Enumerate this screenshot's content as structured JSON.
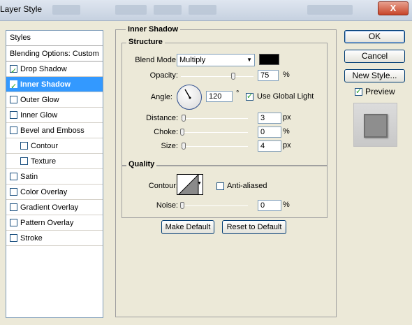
{
  "window": {
    "title": "Layer Style",
    "close_label": "X"
  },
  "styles_panel": {
    "header": "Styles",
    "blending": "Blending Options: Custom",
    "items": [
      {
        "label": "Drop Shadow",
        "checked": true,
        "selected": false,
        "indent": false
      },
      {
        "label": "Inner Shadow",
        "checked": true,
        "selected": true,
        "indent": false
      },
      {
        "label": "Outer Glow",
        "checked": false,
        "selected": false,
        "indent": false
      },
      {
        "label": "Inner Glow",
        "checked": false,
        "selected": false,
        "indent": false
      },
      {
        "label": "Bevel and Emboss",
        "checked": false,
        "selected": false,
        "indent": false
      },
      {
        "label": "Contour",
        "checked": false,
        "selected": false,
        "indent": true
      },
      {
        "label": "Texture",
        "checked": false,
        "selected": false,
        "indent": true
      },
      {
        "label": "Satin",
        "checked": false,
        "selected": false,
        "indent": false
      },
      {
        "label": "Color Overlay",
        "checked": false,
        "selected": false,
        "indent": false
      },
      {
        "label": "Gradient Overlay",
        "checked": false,
        "selected": false,
        "indent": false
      },
      {
        "label": "Pattern Overlay",
        "checked": false,
        "selected": false,
        "indent": false
      },
      {
        "label": "Stroke",
        "checked": false,
        "selected": false,
        "indent": false
      }
    ]
  },
  "inner_shadow": {
    "title": "Inner Shadow",
    "structure": {
      "title": "Structure",
      "blend_mode_label": "Blend Mode:",
      "blend_mode_value": "Multiply",
      "color": "#000000",
      "opacity_label": "Opacity:",
      "opacity_value": "75",
      "opacity_unit": "%",
      "opacity_level": 0.75,
      "angle_label": "Angle:",
      "angle_value": "120",
      "angle_unit": "°",
      "use_global_light_label": "Use Global Light",
      "use_global_light": true,
      "distance_label": "Distance:",
      "distance_value": "3",
      "distance_unit": "px",
      "choke_label": "Choke:",
      "choke_value": "0",
      "choke_unit": "%",
      "size_label": "Size:",
      "size_value": "4",
      "size_unit": "px"
    },
    "quality": {
      "title": "Quality",
      "contour_label": "Contour:",
      "anti_aliased_label": "Anti-aliased",
      "anti_aliased": false,
      "noise_label": "Noise:",
      "noise_value": "0",
      "noise_unit": "%"
    },
    "make_default_label": "Make Default",
    "reset_default_label": "Reset to Default"
  },
  "buttons": {
    "ok": "OK",
    "cancel": "Cancel",
    "new_style": "New Style...",
    "preview_label": "Preview",
    "preview_checked": true
  }
}
